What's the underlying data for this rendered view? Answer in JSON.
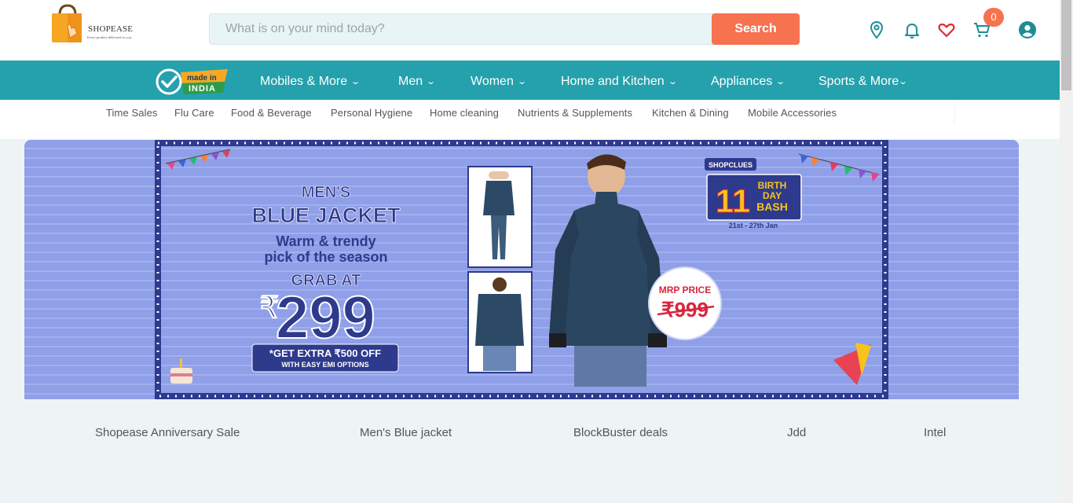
{
  "brand": {
    "name": "SHOPEASE",
    "tagline": "Every product delivered to you."
  },
  "search": {
    "placeholder": "What is on your mind today?",
    "button_label": "Search"
  },
  "header_icons": [
    "location-pin-icon",
    "bell-icon",
    "heart-icon",
    "cart-icon",
    "user-account-icon"
  ],
  "cart": {
    "count": "0"
  },
  "colors": {
    "teal": "#24a1ac",
    "accent": "#f7724f",
    "banner_bg": "#8f9fe8",
    "navy": "#2e3a8c"
  },
  "made_in_india": {
    "top": "made in",
    "bottom": "INDIA"
  },
  "categories": [
    {
      "label": "Mobiles & More"
    },
    {
      "label": "Men"
    },
    {
      "label": "Women"
    },
    {
      "label": "Home and Kitchen"
    },
    {
      "label": "Appliances"
    },
    {
      "label": "Sports & More"
    }
  ],
  "subcategories": [
    "Time Sales",
    "Flu Care",
    "Food & Beverage",
    "Personal Hygiene",
    "Home cleaning",
    "Nutrients & Supplements",
    "Kitchen & Dining",
    "Mobile Accessories"
  ],
  "banner": {
    "line1": "MEN'S",
    "line2": "BLUE JACKET",
    "line3": "Warm & trendy",
    "line4": "pick of the season",
    "grab": "GRAB AT",
    "rupee": "₹",
    "price": "299",
    "offer1": "*GET EXTRA ₹500 OFF",
    "offer2": "WITH EASY EMI OPTIONS",
    "mrp_label": "MRP PRICE",
    "mrp_value": "₹999",
    "badge_brand": "SHOPCLUES",
    "badge_num": "11",
    "badge_l1": "BIRTH",
    "badge_l2": "DAY",
    "badge_l3": "BASH",
    "badge_dates": "21st - 27th Jan"
  },
  "deals": [
    "Shopease Anniversary Sale",
    "Men's Blue jacket",
    "BlockBuster deals",
    "Jdd",
    "Intel"
  ]
}
